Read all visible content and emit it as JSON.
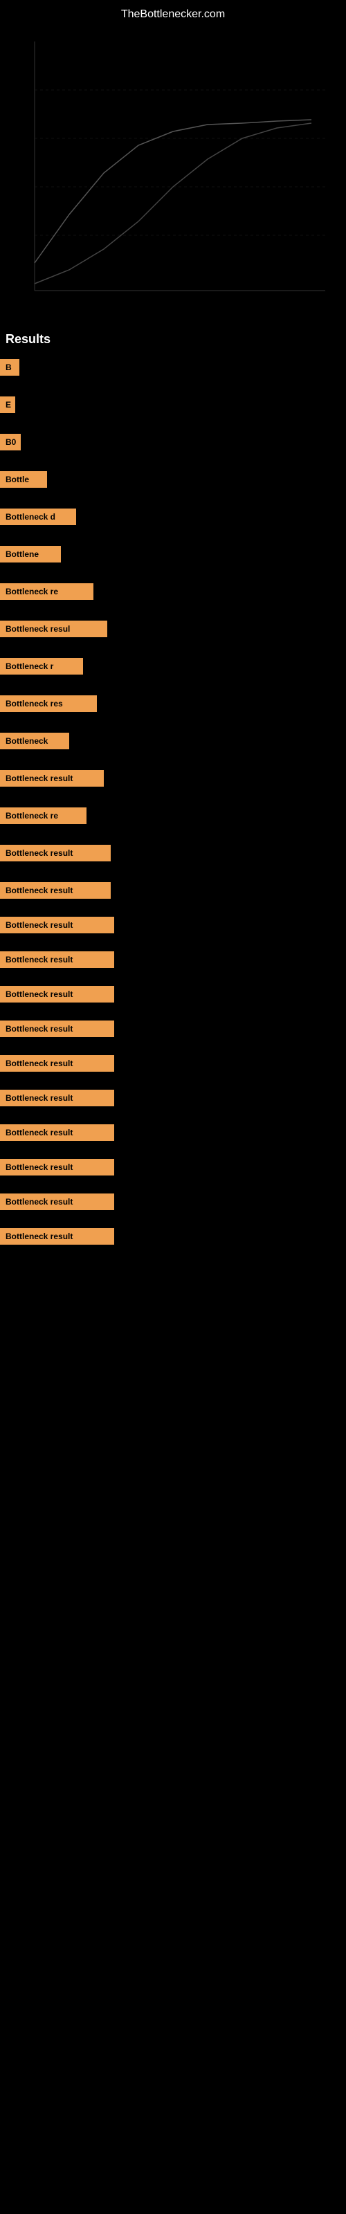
{
  "site": {
    "title": "TheBottlenecker.com"
  },
  "chart": {
    "description": "Performance chart visualization"
  },
  "results_header": "Results",
  "results": [
    {
      "id": "r1",
      "label": "B",
      "width": 28
    },
    {
      "id": "r2",
      "label": "E",
      "width": 22
    },
    {
      "id": "r3",
      "label": "B0",
      "width": 30
    },
    {
      "id": "r4",
      "label": "Bottle",
      "width": 68
    },
    {
      "id": "r5",
      "label": "Bottleneck d",
      "width": 110
    },
    {
      "id": "r6",
      "label": "Bottlene",
      "width": 88
    },
    {
      "id": "r7",
      "label": "Bottleneck re",
      "width": 135
    },
    {
      "id": "r8",
      "label": "Bottleneck resul",
      "width": 155
    },
    {
      "id": "r9",
      "label": "Bottleneck r",
      "width": 120
    },
    {
      "id": "r10",
      "label": "Bottleneck res",
      "width": 140
    },
    {
      "id": "r11",
      "label": "Bottleneck",
      "width": 100
    },
    {
      "id": "r12",
      "label": "Bottleneck result",
      "width": 150
    },
    {
      "id": "r13",
      "label": "Bottleneck re",
      "width": 125
    },
    {
      "id": "r14",
      "label": "Bottleneck result",
      "width": 160
    },
    {
      "id": "r15",
      "label": "Bottleneck result",
      "width": 160
    },
    {
      "id": "r16",
      "label": "Bottleneck result",
      "width": 165
    },
    {
      "id": "r17",
      "label": "Bottleneck result",
      "width": 165
    },
    {
      "id": "r18",
      "label": "Bottleneck result",
      "width": 165
    },
    {
      "id": "r19",
      "label": "Bottleneck result",
      "width": 165
    },
    {
      "id": "r20",
      "label": "Bottleneck result",
      "width": 165
    },
    {
      "id": "r21",
      "label": "Bottleneck result",
      "width": 165
    },
    {
      "id": "r22",
      "label": "Bottleneck result",
      "width": 165
    },
    {
      "id": "r23",
      "label": "Bottleneck result",
      "width": 165
    },
    {
      "id": "r24",
      "label": "Bottleneck result",
      "width": 165
    },
    {
      "id": "r25",
      "label": "Bottleneck result",
      "width": 165
    }
  ]
}
